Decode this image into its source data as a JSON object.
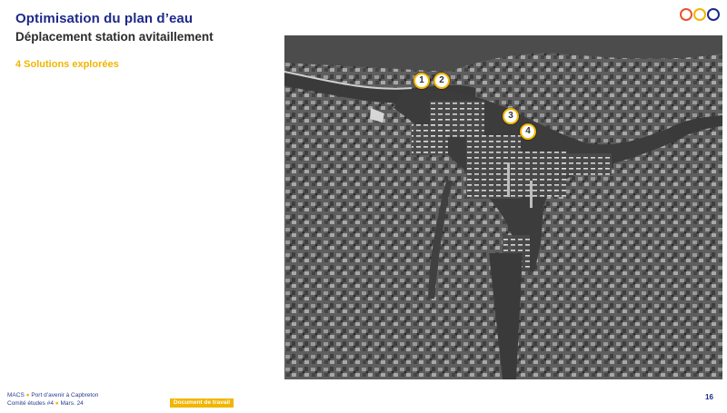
{
  "header": {
    "title": "Optimisation du plan d’eau",
    "subtitle": "Déplacement station avitaillement",
    "section": "4 Solutions explorées"
  },
  "map": {
    "markers": [
      "1",
      "2",
      "3",
      "4"
    ],
    "marker_color": "#f2b500"
  },
  "footer": {
    "line1_project": "MACS",
    "line1_title": "Port d’avenir à Capbreton",
    "line2_meeting": "Comité études #4",
    "line2_date": "Mars. 24",
    "badge": "Document de travail",
    "page_number": "16"
  },
  "colors": {
    "title": "#1e2a8a",
    "accent": "#f2b500"
  }
}
